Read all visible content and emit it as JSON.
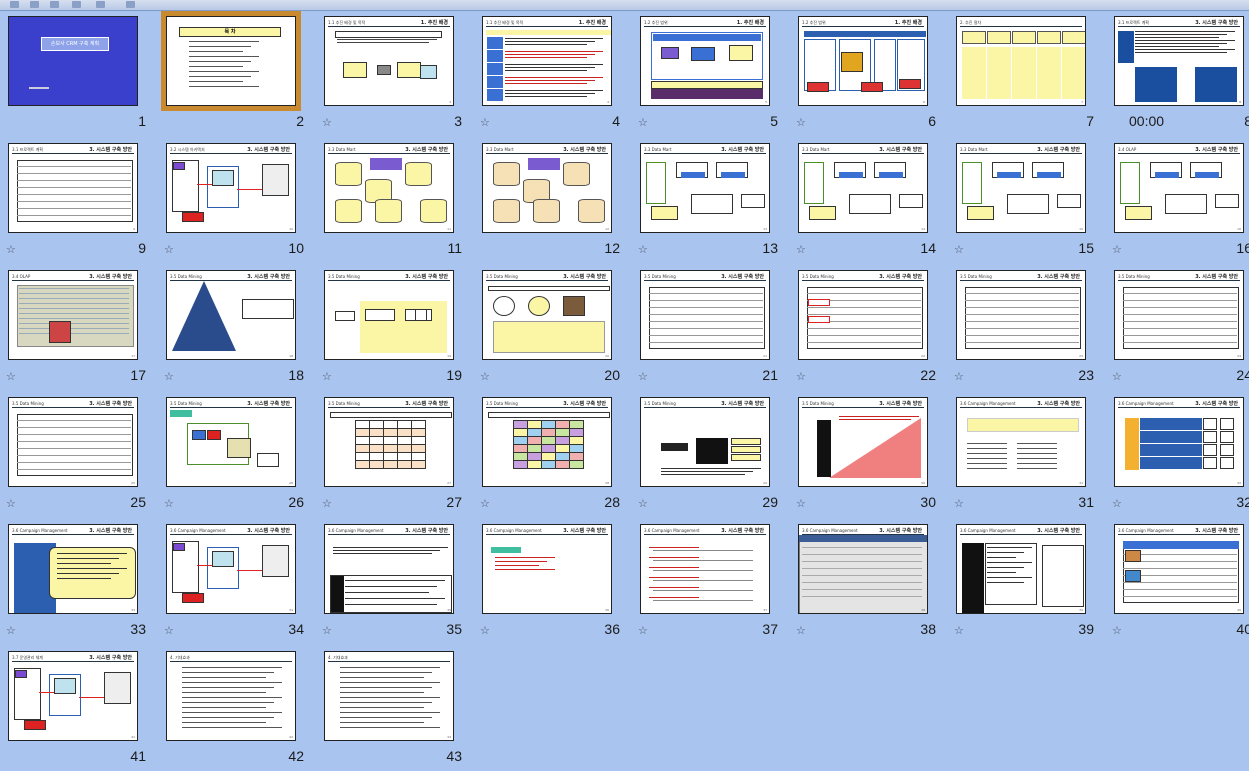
{
  "window": {
    "title": ""
  },
  "slide_sorter": {
    "selected_slide": 2,
    "timing_label": "00:00",
    "slides": [
      {
        "number": "1",
        "title": "손보사 CRM 구축 계획",
        "section": "",
        "style": "title",
        "star": false
      },
      {
        "number": "2",
        "title": "목 차",
        "section": "",
        "style": "toc",
        "star": false
      },
      {
        "number": "3",
        "title": "1.1 추진 배경 및 목적",
        "section": "1. 추진 배경",
        "style": "flow",
        "star": true
      },
      {
        "number": "4",
        "title": "1.1 추진 배경 및 목적",
        "section": "1. 추진 배경",
        "style": "bullets",
        "star": true
      },
      {
        "number": "5",
        "title": "1.2 추진 범위",
        "section": "1. 추진 배경",
        "style": "diagram",
        "star": true
      },
      {
        "number": "6",
        "title": "1.2 추진 범위",
        "section": "1. 추진 배경",
        "style": "blocks",
        "star": true
      },
      {
        "number": "7",
        "title": "2. 추진 절차",
        "section": "",
        "style": "arrows",
        "star": false
      },
      {
        "number": "8",
        "title": "3.1 프로젝트 계획",
        "section": "3. 시스템 구축 방안",
        "style": "blue-boxes",
        "star": false
      },
      {
        "number": "9",
        "title": "3.1 프로젝트 계획",
        "section": "3. 시스템 구축 방안",
        "style": "table",
        "star": true
      },
      {
        "number": "10",
        "title": "3.2 시스템 아키텍처",
        "section": "3. 시스템 구축 방안",
        "style": "architecture",
        "star": true
      },
      {
        "number": "11",
        "title": "3.3 Data Mart",
        "section": "3. 시스템 구축 방안",
        "style": "cylinders",
        "star": false
      },
      {
        "number": "12",
        "title": "3.3 Data Mart",
        "section": "3. 시스템 구축 방안",
        "style": "cylinders2",
        "star": false
      },
      {
        "number": "13",
        "title": "3.3 Data Mart",
        "section": "3. 시스템 구축 방안",
        "style": "process",
        "star": true
      },
      {
        "number": "14",
        "title": "3.3 Data Mart",
        "section": "3. 시스템 구축 방안",
        "style": "process",
        "star": true
      },
      {
        "number": "15",
        "title": "3.3 Data Mart",
        "section": "3. 시스템 구축 방안",
        "style": "process",
        "star": true
      },
      {
        "number": "16",
        "title": "3.4 OLAP",
        "section": "3. 시스템 구축 방안",
        "style": "process",
        "star": true
      },
      {
        "number": "17",
        "title": "3.4 OLAP",
        "section": "3. 시스템 구축 방안",
        "style": "screenshot",
        "star": true
      },
      {
        "number": "18",
        "title": "3.5 Data Mining",
        "section": "3. 시스템 구축 방안",
        "style": "pyramid",
        "star": true
      },
      {
        "number": "19",
        "title": "3.5 Data Mining",
        "section": "3. 시스템 구축 방안",
        "style": "flow-yellow",
        "star": true
      },
      {
        "number": "20",
        "title": "3.5 Data Mining",
        "section": "3. 시스템 구축 방안",
        "style": "circles",
        "star": true
      },
      {
        "number": "21",
        "title": "3.5 Data Mining",
        "section": "3. 시스템 구축 방안",
        "style": "table",
        "star": true
      },
      {
        "number": "22",
        "title": "3.5 Data Mining",
        "section": "3. 시스템 구축 방안",
        "style": "table-red",
        "star": true
      },
      {
        "number": "23",
        "title": "3.5 Data Mining",
        "section": "3. 시스템 구축 방안",
        "style": "table",
        "star": true
      },
      {
        "number": "24",
        "title": "3.5 Data Mining",
        "section": "3. 시스템 구축 방안",
        "style": "table",
        "star": true
      },
      {
        "number": "25",
        "title": "3.5 Data Mining",
        "section": "3. 시스템 구축 방안",
        "style": "table",
        "star": true
      },
      {
        "number": "26",
        "title": "3.5 Data Mining",
        "section": "3. 시스템 구축 방안",
        "style": "tree",
        "star": true
      },
      {
        "number": "27",
        "title": "3.5 Data Mining",
        "section": "3. 시스템 구축 방안",
        "style": "grid",
        "star": true
      },
      {
        "number": "28",
        "title": "3.5 Data Mining",
        "section": "3. 시스템 구축 방안",
        "style": "grid-colored",
        "star": true
      },
      {
        "number": "29",
        "title": "3.5 Data Mining",
        "section": "3. 시스템 구축 방안",
        "style": "black-box",
        "star": true
      },
      {
        "number": "30",
        "title": "3.5 Data Mining",
        "section": "3. 시스템 구축 방안",
        "style": "triangle",
        "star": true
      },
      {
        "number": "31",
        "title": "3.6 Campaign Management",
        "section": "3. 시스템 구축 방안",
        "style": "yellow-list",
        "star": true
      },
      {
        "number": "32",
        "title": "3.6 Campaign Management",
        "section": "3. 시스템 구축 방안",
        "style": "cycle",
        "star": true
      },
      {
        "number": "33",
        "title": "3.6 Campaign Management",
        "section": "3. 시스템 구축 방안",
        "style": "campaign",
        "star": true
      },
      {
        "number": "34",
        "title": "3.6 Campaign Management",
        "section": "3. 시스템 구축 방안",
        "style": "architecture",
        "star": true
      },
      {
        "number": "35",
        "title": "3.6 Campaign Management",
        "section": "3. 시스템 구축 방안",
        "style": "black-table",
        "star": true
      },
      {
        "number": "36",
        "title": "3.6 Campaign Management",
        "section": "3. 시스템 구축 방안",
        "style": "sparse",
        "star": true
      },
      {
        "number": "37",
        "title": "3.6 Campaign Management",
        "section": "3. 시스템 구축 방안",
        "style": "red-lines",
        "star": true
      },
      {
        "number": "38",
        "title": "3.6 Campaign Management",
        "section": "3. 시스템 구축 방안",
        "style": "screenshot2",
        "star": true
      },
      {
        "number": "39",
        "title": "3.6 Campaign Management",
        "section": "3. 시스템 구축 방안",
        "style": "black-side",
        "star": true
      },
      {
        "number": "40",
        "title": "3.6 Campaign Management",
        "section": "3. 시스템 구축 방안",
        "style": "table-blue",
        "star": true
      },
      {
        "number": "41",
        "title": "3.7 운영관리 체계",
        "section": "3. 시스템 구축 방안",
        "style": "architecture",
        "star": false
      },
      {
        "number": "42",
        "title": "4. 기대효과",
        "section": "",
        "style": "text",
        "star": false
      },
      {
        "number": "43",
        "title": "4. 기대효과",
        "section": "",
        "style": "text",
        "star": false
      }
    ]
  },
  "colors": {
    "background": "#a9c4ee",
    "selection": "#c8892f",
    "title_slide": "#3a3fcc",
    "accent_yellow": "#fbf5a6",
    "accent_blue": "#3a6fd4"
  },
  "icons": {
    "transition": "star-icon"
  }
}
